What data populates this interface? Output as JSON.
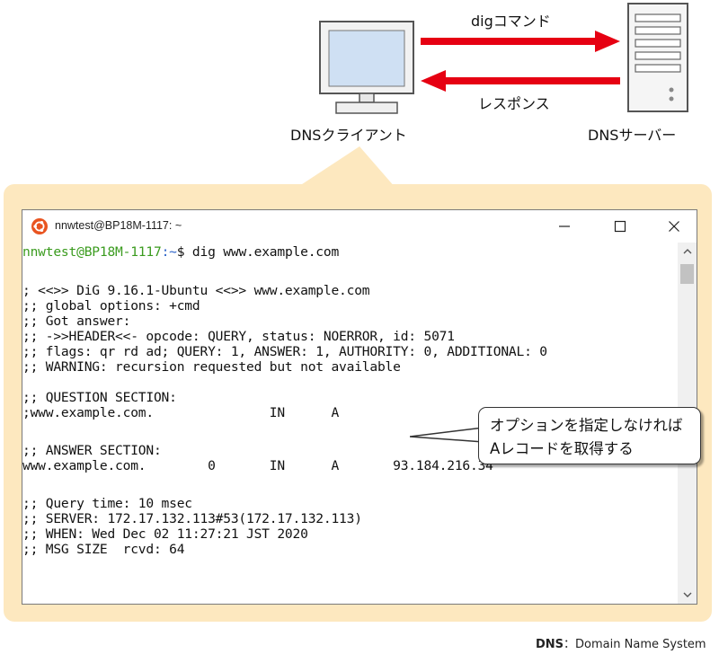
{
  "diagram": {
    "client_label": "DNSクライアント",
    "server_label": "DNSサーバー",
    "request_label": "digコマンド",
    "response_label": "レスポンス",
    "arrow_color": "#e60012"
  },
  "window": {
    "title": "nnwtest@BP18M-1117: ~",
    "minimize_glyph": "—",
    "maximize_glyph": "☐",
    "close_glyph": "✕"
  },
  "terminal": {
    "prompt_user": "nnwtest@BP18M-1117",
    "prompt_path": ":~",
    "prompt_command": "$ dig www.example.com",
    "lines": [
      "; <<>> DiG 9.16.1-Ubuntu <<>> www.example.com",
      ";; global options: +cmd",
      ";; Got answer:",
      ";; ->>HEADER<<- opcode: QUERY, status: NOERROR, id: 5071",
      ";; flags: qr rd ad; QUERY: 1, ANSWER: 1, AUTHORITY: 0, ADDITIONAL: 0",
      ";; WARNING: recursion requested but not available",
      "",
      ";; QUESTION SECTION:",
      ";www.example.com.               IN      A",
      "",
      ";; ANSWER SECTION:",
      "www.example.com.        0       IN      A       93.184.216.34",
      "",
      ";; Query time: 10 msec",
      ";; SERVER: 172.17.132.113#53(172.17.132.113)",
      ";; WHEN: Wed Dec 02 11:27:21 JST 2020",
      ";; MSG SIZE  rcvd: 64"
    ]
  },
  "annotation": {
    "line1": "オプションを指定しなければ",
    "line2": "Aレコードを取得する"
  },
  "footnote": {
    "abbr": "DNS",
    "expansion": "：Domain Name System"
  }
}
